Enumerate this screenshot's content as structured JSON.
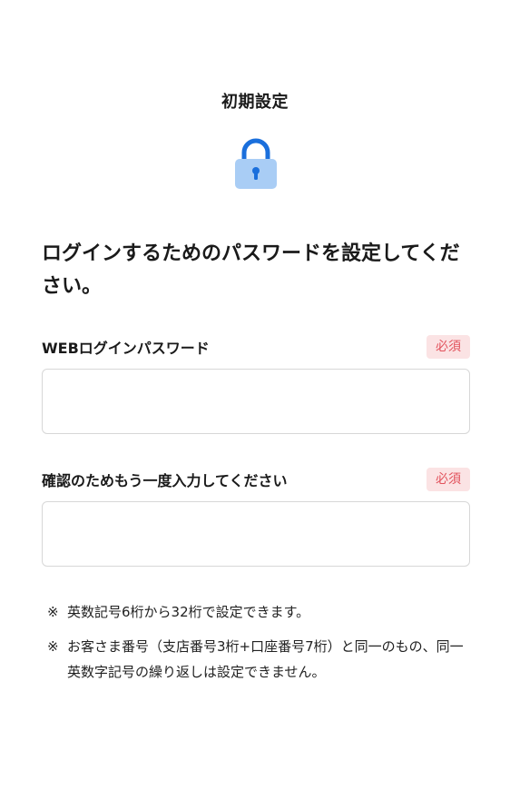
{
  "header": {
    "title": "初期設定"
  },
  "icons": {
    "lock": "lock-icon"
  },
  "colors": {
    "accent": "#1a6fdc",
    "lock_body": "#a9cdf5",
    "required_badge_bg": "#fbe3e4",
    "required_badge_text": "#e2525c",
    "input_border": "#d7d7d7"
  },
  "main": {
    "headline": "ログインするためのパスワードを設定してください。",
    "password_field": {
      "label": "WEBログインパスワード",
      "required_label": "必須",
      "value": "",
      "placeholder": ""
    },
    "confirm_field": {
      "label": "確認のためもう一度入力してください",
      "required_label": "必須",
      "value": "",
      "placeholder": ""
    },
    "notes": [
      {
        "mark": "※",
        "text": "英数記号6桁から32桁で設定できます。"
      },
      {
        "mark": "※",
        "text": "お客さま番号（支店番号3桁+口座番号7桁）と同一のもの、同一英数字記号の繰り返しは設定できません。"
      }
    ]
  }
}
